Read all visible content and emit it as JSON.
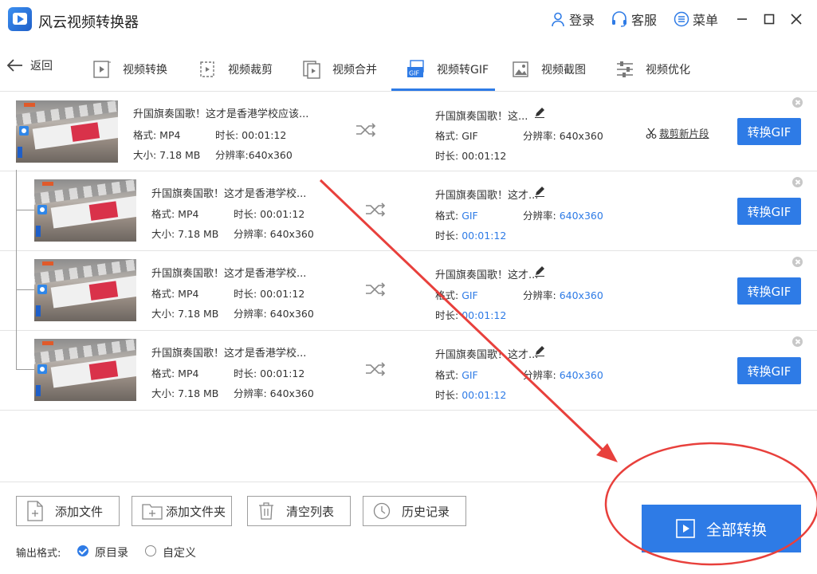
{
  "app": {
    "title": "风云视频转换器"
  },
  "titlebar": {
    "login": "登录",
    "service": "客服",
    "menu": "菜单"
  },
  "tabs": {
    "back": "返回",
    "items": [
      {
        "label": "视频转换",
        "icon": "video-convert-icon"
      },
      {
        "label": "视频裁剪",
        "icon": "video-crop-icon"
      },
      {
        "label": "视频合并",
        "icon": "video-merge-icon"
      },
      {
        "label": "视频转GIF",
        "icon": "video-to-gif-icon",
        "active": true
      },
      {
        "label": "视频截图",
        "icon": "video-screenshot-icon"
      },
      {
        "label": "视频优化",
        "icon": "video-optimize-icon"
      }
    ]
  },
  "rows": [
    {
      "src_name": "升国旗奏国歌！这才是香港学校应该...",
      "src_format": "格式: MP4",
      "src_duration": "时长: 00:01:12",
      "src_size": "大小: 7.18 MB",
      "src_resolution": "分辨率:640x360",
      "out_name": "升国旗奏国歌！这...",
      "out_format_label": "格式: ",
      "out_format": "GIF",
      "out_resolution_label": "分辨率: ",
      "out_resolution": "640x360",
      "out_duration_label": "时长: ",
      "out_duration": "00:01:12",
      "trim_link": "裁剪新片段",
      "convert": "转换GIF"
    },
    {
      "src_name": "升国旗奏国歌！这才是香港学校...",
      "src_format": "格式: MP4",
      "src_duration": "时长: 00:01:12",
      "src_size": "大小: 7.18 MB",
      "src_resolution": "分辨率: 640x360",
      "out_name": "升国旗奏国歌！这才...",
      "out_format_label": "格式: ",
      "out_format": "GIF",
      "out_resolution_label": "分辨率: ",
      "out_resolution": "640x360",
      "out_duration_label": "时长: ",
      "out_duration": "00:01:12",
      "convert": "转换GIF"
    },
    {
      "src_name": "升国旗奏国歌！这才是香港学校...",
      "src_format": "格式: MP4",
      "src_duration": "时长: 00:01:12",
      "src_size": "大小: 7.18 MB",
      "src_resolution": "分辨率: 640x360",
      "out_name": "升国旗奏国歌！这才...",
      "out_format_label": "格式: ",
      "out_format": "GIF",
      "out_resolution_label": "分辨率: ",
      "out_resolution": "640x360",
      "out_duration_label": "时长: ",
      "out_duration": "00:01:12",
      "convert": "转换GIF"
    },
    {
      "src_name": "升国旗奏国歌！这才是香港学校...",
      "src_format": "格式: MP4",
      "src_duration": "时长: 00:01:12",
      "src_size": "大小: 7.18 MB",
      "src_resolution": "分辨率: 640x360",
      "out_name": "升国旗奏国歌！这才...",
      "out_format_label": "格式: ",
      "out_format": "GIF",
      "out_resolution_label": "分辨率: ",
      "out_resolution": "640x360",
      "out_duration_label": "时长: ",
      "out_duration": "00:01:12",
      "convert": "转换GIF"
    }
  ],
  "footer": {
    "add_file": "添加文件",
    "add_folder": "添加文件夹",
    "clear_list": "清空列表",
    "history": "历史记录",
    "output_format_label": "输出格式:",
    "option_original": "原目录",
    "option_custom": "自定义",
    "convert_all": "全部转换"
  },
  "colors": {
    "accent": "#2e7be6",
    "annotation": "#e8403c"
  }
}
